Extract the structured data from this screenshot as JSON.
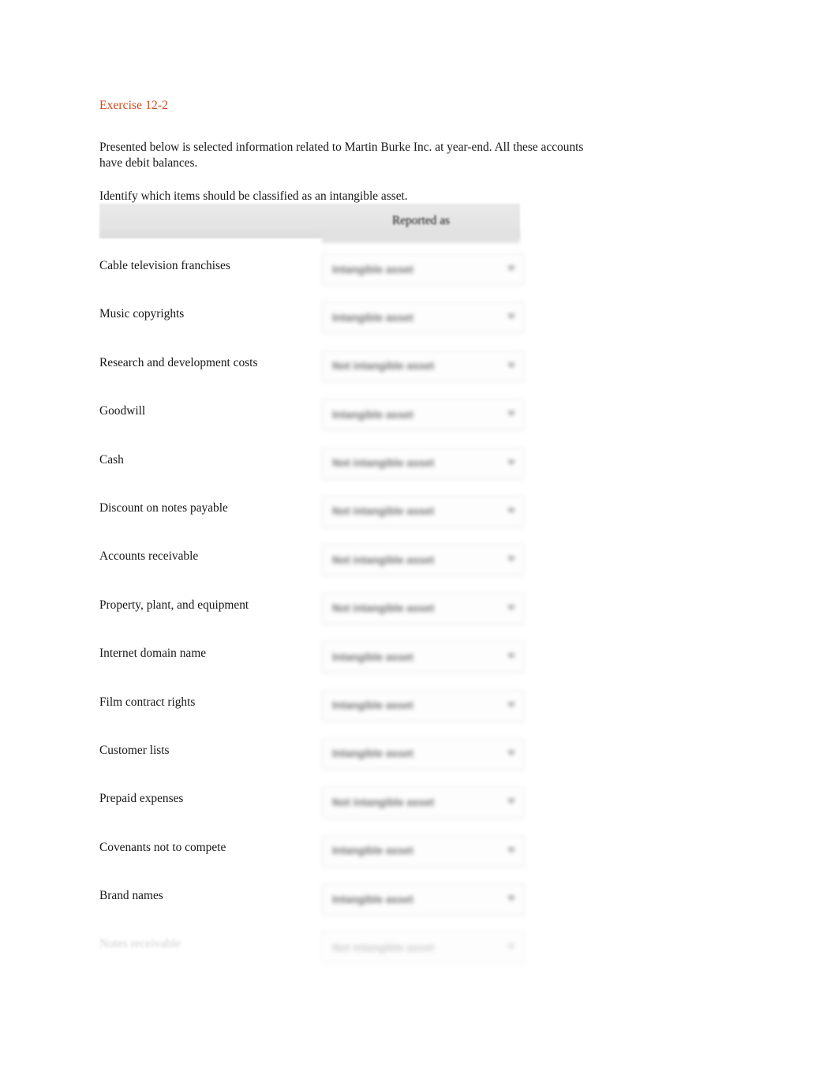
{
  "document": {
    "exercise_title": "Exercise 12-2",
    "intro_paragraph": "Presented below is selected information related to Martin Burke Inc. at year-end. All these accounts have debit balances.",
    "instruction_paragraph": "Identify which items should be classified as an intangible asset."
  },
  "table": {
    "header": {
      "item_column": "",
      "reported_as_column": "Reported as"
    },
    "options": [
      "Intangible asset",
      "Not intangible asset"
    ],
    "rows": [
      {
        "item": "Cable television franchises",
        "reported_as": "Intangible asset"
      },
      {
        "item": "Music copyrights",
        "reported_as": "Intangible asset"
      },
      {
        "item": "Research and development costs",
        "reported_as": "Not intangible asset"
      },
      {
        "item": "Goodwill",
        "reported_as": "Intangible asset"
      },
      {
        "item": "Cash",
        "reported_as": "Not intangible asset"
      },
      {
        "item": "Discount on notes payable",
        "reported_as": "Not intangible asset"
      },
      {
        "item": "Accounts receivable",
        "reported_as": "Not intangible asset"
      },
      {
        "item": "Property, plant, and equipment",
        "reported_as": "Not intangible asset"
      },
      {
        "item": "Internet domain name",
        "reported_as": "Intangible asset"
      },
      {
        "item": "Film contract rights",
        "reported_as": "Intangible asset"
      },
      {
        "item": "Customer lists",
        "reported_as": "Intangible asset"
      },
      {
        "item": "Prepaid expenses",
        "reported_as": "Not intangible asset"
      },
      {
        "item": "Covenants not to compete",
        "reported_as": "Intangible asset"
      },
      {
        "item": "Brand names",
        "reported_as": "Intangible asset"
      },
      {
        "item": "Notes receivable",
        "reported_as": "Not intangible asset"
      }
    ]
  },
  "colors": {
    "title_accent": "#d4481b",
    "header_band": "#e4e4e4",
    "body_text": "#181818"
  }
}
